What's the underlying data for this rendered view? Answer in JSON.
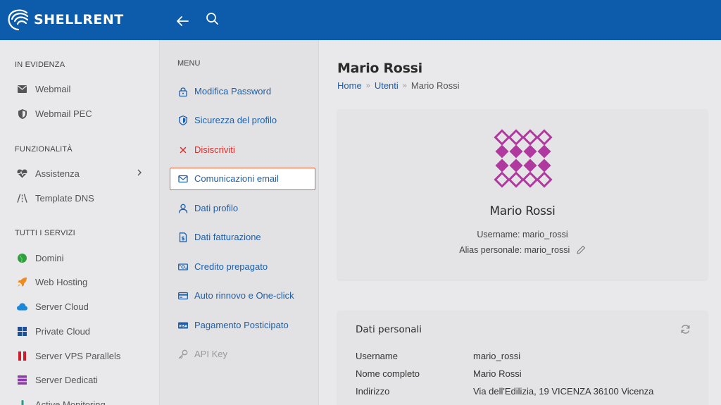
{
  "brand": {
    "name": "SHELLRENT",
    "color": "#0d5bab"
  },
  "sidebar": {
    "sections": [
      {
        "title": "IN EVIDENZA",
        "items": [
          {
            "label": "Webmail",
            "icon": "envelope-icon"
          },
          {
            "label": "Webmail PEC",
            "icon": "shield-icon"
          }
        ]
      },
      {
        "title": "FUNZIONALITÀ",
        "items": [
          {
            "label": "Assistenza",
            "icon": "heart-pulse-icon"
          },
          {
            "label": "Template DNS",
            "icon": "road-icon"
          }
        ]
      },
      {
        "title": "TUTTI I SERVIZI",
        "items": [
          {
            "label": "Domini",
            "icon": "globe-icon"
          },
          {
            "label": "Web Hosting",
            "icon": "rocket-icon"
          },
          {
            "label": "Server Cloud",
            "icon": "cloud-icon"
          },
          {
            "label": "Private Cloud",
            "icon": "grid-icon"
          },
          {
            "label": "Server VPS Parallels",
            "icon": "parallels-icon"
          },
          {
            "label": "Server Dedicati",
            "icon": "server-icon"
          },
          {
            "label": "Active Monitoring",
            "icon": "monitor-icon"
          }
        ]
      }
    ]
  },
  "menu": {
    "title": "MENU",
    "items": [
      {
        "label": "Modifica Password",
        "icon": "lock-icon"
      },
      {
        "label": "Sicurezza del profilo",
        "icon": "shield-icon"
      },
      {
        "label": "Disiscriviti",
        "icon": "close-icon"
      },
      {
        "label": "Comunicazioni email",
        "icon": "envelope-icon"
      },
      {
        "label": "Dati profilo",
        "icon": "user-icon"
      },
      {
        "label": "Dati fatturazione",
        "icon": "invoice-icon"
      },
      {
        "label": "Credito prepagato",
        "icon": "money-icon"
      },
      {
        "label": "Auto rinnovo e One-click",
        "icon": "credit-card-icon"
      },
      {
        "label": "Pagamento Posticipato",
        "icon": "visa-icon"
      },
      {
        "label": "API Key",
        "icon": "key-icon"
      }
    ]
  },
  "main": {
    "title": "Mario Rossi",
    "breadcrumb": [
      "Home",
      "Utenti",
      "Mario Rossi"
    ],
    "profile": {
      "name": "Mario Rossi",
      "username_label": "Username:",
      "username": "mario_rossi",
      "alias_label": "Alias personale:",
      "alias": "mario_rossi",
      "avatar_color": "#b0399f"
    },
    "personal": {
      "title": "Dati personali",
      "rows": [
        {
          "key": "Username",
          "value": "mario_rossi"
        },
        {
          "key": "Nome completo",
          "value": "Mario Rossi"
        },
        {
          "key": "Indirizzo",
          "value": "Via dell'Edilizia, 19 VICENZA 36100 Vicenza"
        }
      ]
    }
  }
}
